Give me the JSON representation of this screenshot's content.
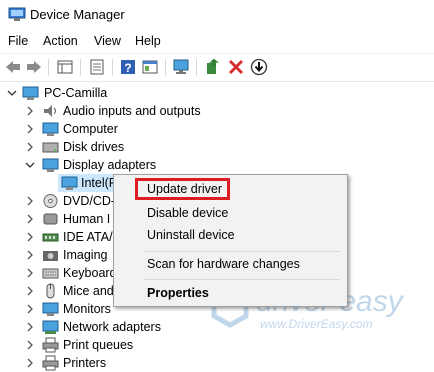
{
  "window": {
    "title": "Device Manager"
  },
  "menu": [
    {
      "label": "File"
    },
    {
      "label": "Action"
    },
    {
      "label": "View"
    },
    {
      "label": "Help"
    }
  ],
  "toolbar": {
    "icons": [
      "back-arrow-icon",
      "forward-arrow-icon",
      "properties-grid-icon",
      "show-hide-icon",
      "help-icon",
      "view-panel-icon",
      "monitor-scan-icon",
      "update-driver-icon",
      "uninstall-x-icon",
      "download-icon"
    ]
  },
  "tree": {
    "root": "PC-Camilla",
    "items": [
      {
        "label": "Audio inputs and outputs",
        "icon": "audio-icon",
        "expanded": false
      },
      {
        "label": "Computer",
        "icon": "computer-icon",
        "expanded": false
      },
      {
        "label": "Disk drives",
        "icon": "disk-icon",
        "expanded": false
      },
      {
        "label": "Display adapters",
        "icon": "display-icon",
        "expanded": true
      },
      {
        "label": "Intel(R",
        "icon": "display-adapter-icon",
        "child": true,
        "selected": true
      },
      {
        "label": "DVD/CD-",
        "icon": "dvd-icon",
        "expanded": false
      },
      {
        "label": "Human I",
        "icon": "hid-icon",
        "expanded": false
      },
      {
        "label": "IDE ATA/",
        "icon": "ide-icon",
        "expanded": false
      },
      {
        "label": "Imaging",
        "icon": "camera-icon",
        "expanded": false
      },
      {
        "label": "Keyboard",
        "icon": "keyboard-icon",
        "expanded": false
      },
      {
        "label": "Mice and",
        "icon": "mouse-icon",
        "expanded": false
      },
      {
        "label": "Monitors",
        "icon": "monitor-icon",
        "expanded": false
      },
      {
        "label": "Network adapters",
        "icon": "network-icon",
        "expanded": false
      },
      {
        "label": "Print queues",
        "icon": "printer-icon",
        "expanded": false
      },
      {
        "label": "Printers",
        "icon": "printer-icon",
        "expanded": false
      }
    ]
  },
  "context_menu": {
    "update_driver": "Update driver",
    "disable_device": "Disable device",
    "uninstall_device": "Uninstall device",
    "scan": "Scan for hardware changes",
    "properties": "Properties"
  },
  "watermark": {
    "brand": "driver easy",
    "url": "www.DriverEasy.com"
  },
  "colors": {
    "highlight": "#e01b24",
    "selection": "#cce8ff",
    "brand": "#1f6fb5"
  }
}
